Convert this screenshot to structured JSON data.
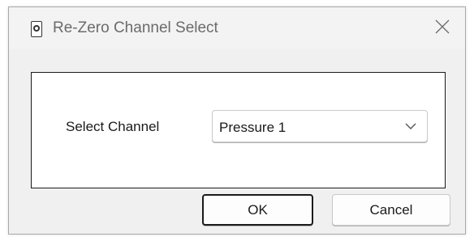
{
  "window": {
    "title": "Re-Zero Channel Select",
    "app_icon": "device-icon",
    "close_icon": "close-icon"
  },
  "form": {
    "channel_label": "Select Channel",
    "channel_select": {
      "selected": "Pressure 1",
      "icon": "chevron-down-icon"
    }
  },
  "buttons": {
    "ok_label": "OK",
    "cancel_label": "Cancel"
  },
  "colors": {
    "dialog_bg": "#f0f0f0",
    "panel_bg": "#ffffff",
    "default_button_border": "#1b1b1b"
  }
}
